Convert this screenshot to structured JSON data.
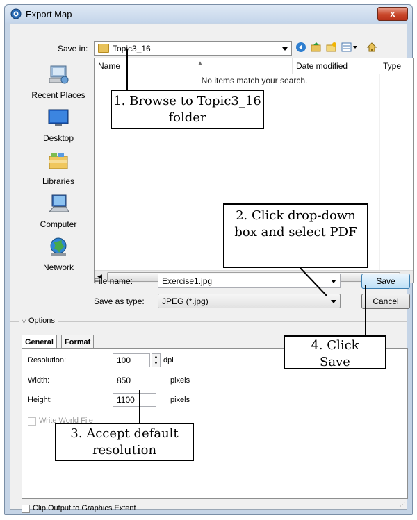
{
  "window": {
    "title": "Export Map",
    "close": "x"
  },
  "save_in": {
    "label": "Save in:",
    "value": "Topic3_16"
  },
  "places": [
    {
      "label": "Recent Places",
      "icon": "recent-places-icon"
    },
    {
      "label": "Desktop",
      "icon": "desktop-icon"
    },
    {
      "label": "Libraries",
      "icon": "libraries-icon"
    },
    {
      "label": "Computer",
      "icon": "computer-icon"
    },
    {
      "label": "Network",
      "icon": "network-icon"
    }
  ],
  "file_list": {
    "columns": [
      "Name",
      "Date modified",
      "Type"
    ],
    "empty_message": "No items match your search."
  },
  "file_name": {
    "label": "File name:",
    "value": "Exercise1.jpg"
  },
  "save_as_type": {
    "label": "Save as type:",
    "value": "JPEG (*.jpg)"
  },
  "buttons": {
    "save": "Save",
    "cancel": "Cancel"
  },
  "options": {
    "header": "Options",
    "tabs": [
      "General",
      "Format"
    ],
    "resolution": {
      "label": "Resolution:",
      "value": "100",
      "unit": "dpi"
    },
    "width": {
      "label": "Width:",
      "value": "850",
      "unit": "pixels"
    },
    "height": {
      "label": "Height:",
      "value": "1100",
      "unit": "pixels"
    },
    "world_file": "Write World File",
    "clip": "Clip Output to Graphics Extent"
  },
  "callouts": [
    "1. Browse to Topic3_16 folder",
    "2. Click drop-down box and select PDF",
    "3. Accept default resolution",
    "4. Click Save"
  ],
  "colors": {
    "title_bar": "#c4d5ea",
    "close": "#c9472a",
    "accent": "#3c7fb1"
  }
}
